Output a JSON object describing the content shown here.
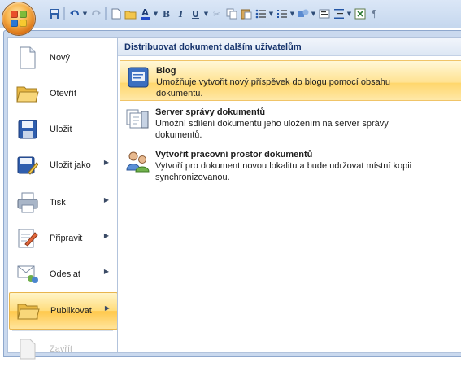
{
  "qat": {
    "icons": [
      "save-icon",
      "undo-icon",
      "undo-dropdown-icon",
      "redo-icon",
      "new-document-icon",
      "open-folder-icon",
      "font-color-icon",
      "font-color-dropdown-icon",
      "bold-icon",
      "italic-icon",
      "underline-icon",
      "underline-dropdown-icon",
      "cut-icon",
      "copy-icon",
      "paste-icon",
      "bullets-icon",
      "bullets-dropdown-icon",
      "numbering-icon",
      "numbering-dropdown-icon",
      "shapes-icon",
      "shapes-dropdown-icon",
      "text-box-icon",
      "spacing-icon",
      "spacing-dropdown-icon",
      "excel-icon",
      "show-formatting-icon"
    ],
    "font_color_glyph": "A",
    "bold_glyph": "B",
    "italic_glyph": "I",
    "underline_glyph": "U",
    "pilcrow_glyph": "¶"
  },
  "menu": {
    "items": [
      {
        "id": "new",
        "label": "Nový",
        "has_submenu": false
      },
      {
        "id": "open",
        "label": "Otevřít",
        "has_submenu": false
      },
      {
        "id": "save",
        "label": "Uložit",
        "has_submenu": false
      },
      {
        "id": "save_as",
        "label": "Uložit jako",
        "has_submenu": true
      },
      {
        "id": "print",
        "label": "Tisk",
        "has_submenu": true
      },
      {
        "id": "prepare",
        "label": "Připravit",
        "has_submenu": true
      },
      {
        "id": "send",
        "label": "Odeslat",
        "has_submenu": true
      },
      {
        "id": "publish",
        "label": "Publikovat",
        "has_submenu": true,
        "active": true
      },
      {
        "id": "close",
        "label": "Zavřít",
        "has_submenu": false,
        "disabled": true
      }
    ],
    "arrow_glyph": "▶"
  },
  "panel": {
    "header": "Distribuovat dokument dalším uživatelům",
    "entries": [
      {
        "title": "Blog",
        "description": "Umožňuje vytvořit nový příspěvek do blogu pomocí obsahu dokumentu.",
        "active": true
      },
      {
        "title": "Server správy dokumentů",
        "description": "Umožní sdílení dokumentu jeho uložením na server správy dokumentů.",
        "active": false
      },
      {
        "title": "Vytvořit pracovní prostor dokumentů",
        "description": "Vytvoří pro dokument novou lokalitu a bude udržovat místní kopii synchronizovanou.",
        "active": false
      }
    ]
  },
  "colors": {
    "accent_blue": "#15326b",
    "highlight_gold": "#ffd66b",
    "office_orange": "#f7b24a"
  }
}
